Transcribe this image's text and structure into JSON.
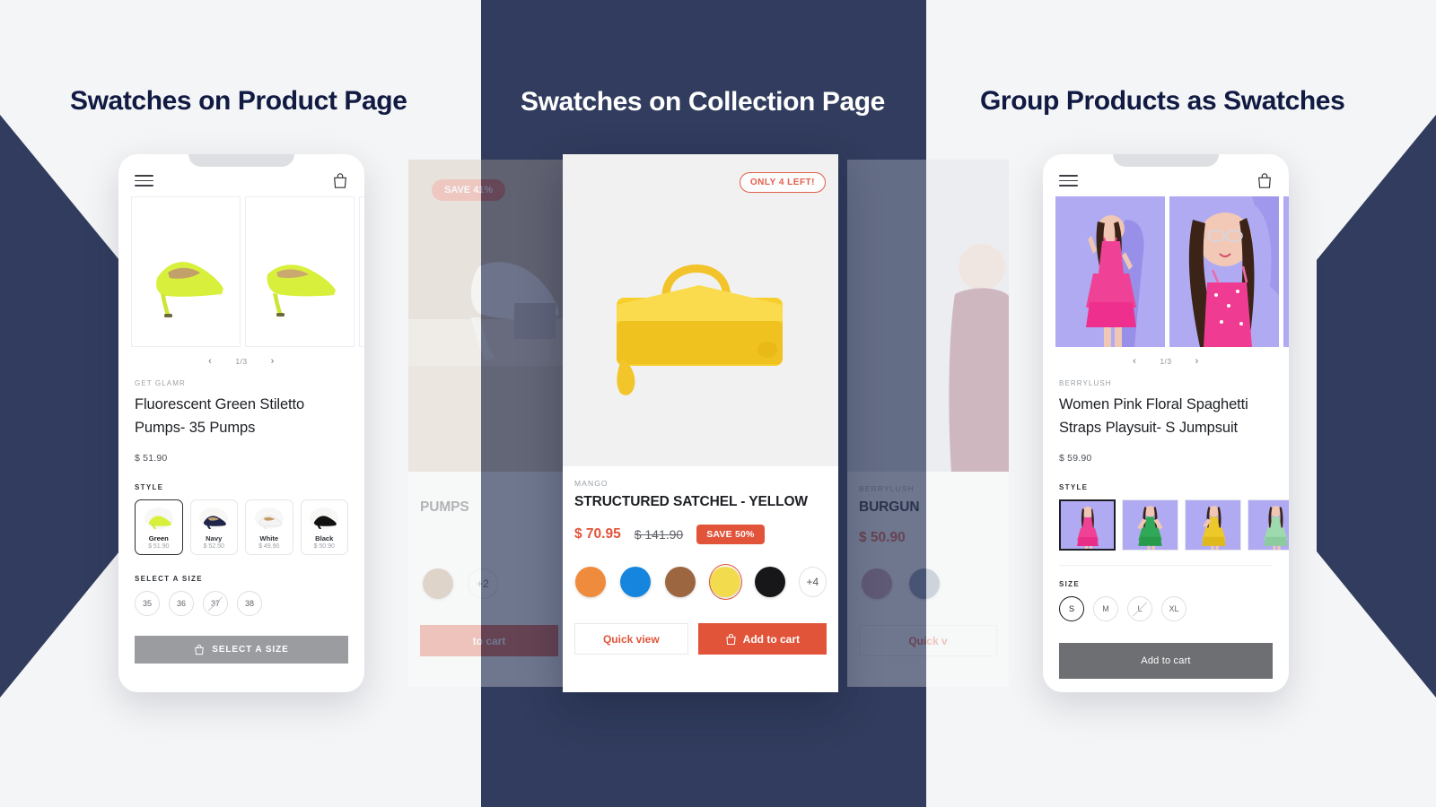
{
  "colors": {
    "navy": "#313c5e",
    "navy_title": "#101a42",
    "page_bg": "#f4f5f6",
    "accent_red": "#e1543a",
    "gray_cta": "#9a9ca0",
    "gray_cta_dark": "#6d6f72"
  },
  "panels": [
    {
      "title": "Swatches on Product Page"
    },
    {
      "title": "Swatches on Collection Page"
    },
    {
      "title": "Group Products as Swatches"
    }
  ],
  "product_page": {
    "carousel": {
      "counter": "1/3",
      "prev": "‹",
      "next": "›"
    },
    "vendor": "GET GLAMR",
    "title": "Fluorescent Green Stiletto Pumps- 35 Pumps",
    "price": "$ 51.90",
    "style_label": "STYLE",
    "styles": [
      {
        "name": "Green",
        "price": "$ 51.90",
        "selected": true,
        "color": "#d4f23a"
      },
      {
        "name": "Navy",
        "price": "$ 52.50",
        "selected": false,
        "color": "#20264a"
      },
      {
        "name": "White",
        "price": "$ 49.90",
        "selected": false,
        "color": "#f2f2f2"
      },
      {
        "name": "Black",
        "price": "$ 50.90",
        "selected": false,
        "color": "#121212"
      }
    ],
    "size_label": "SELECT A SIZE",
    "sizes": [
      {
        "label": "35",
        "selected": false,
        "unavailable": false
      },
      {
        "label": "36",
        "selected": false,
        "unavailable": false
      },
      {
        "label": "37",
        "selected": false,
        "unavailable": true
      },
      {
        "label": "38",
        "selected": false,
        "unavailable": false
      }
    ],
    "cta": "SELECT A SIZE"
  },
  "collection_page": {
    "main_card": {
      "stock_badge": "ONLY 4 LEFT!",
      "vendor": "MANGO",
      "title": "STRUCTURED SATCHEL - YELLOW",
      "price_now": "$ 70.95",
      "price_was": "$ 141.90",
      "save_pill": "SAVE 50%",
      "swatches": [
        {
          "name": "orange",
          "color": "#ef8b3c",
          "selected": false
        },
        {
          "name": "blue",
          "color": "#1585de",
          "selected": false
        },
        {
          "name": "brown",
          "color": "#9c6640",
          "selected": false
        },
        {
          "name": "yellow",
          "color": "#f2dc4e",
          "selected": true
        },
        {
          "name": "black",
          "color": "#17171a",
          "selected": false
        }
      ],
      "more_swatches": "+4",
      "quick_view": "Quick view",
      "add_to_cart": "Add to cart"
    },
    "left_card": {
      "save_badge": "SAVE 41%",
      "title": "PUMPS",
      "more_swatches": "+2",
      "swatch_color": "#b08b68",
      "add_to_cart": "to cart"
    },
    "right_card": {
      "vendor": "BERRYLUSH",
      "title": "BURGUN",
      "price_now": "$ 50.90",
      "swatches": [
        {
          "name": "pink",
          "color": "#c99cb0"
        },
        {
          "name": "slate-blue",
          "color": "#7a8ba3"
        }
      ],
      "quick_view": "Quick v"
    }
  },
  "group_products": {
    "carousel": {
      "counter": "1/3",
      "prev": "‹",
      "next": "›"
    },
    "vendor": "BERRYLUSH",
    "title": "Women Pink Floral Spaghetti Straps Playsuit- S Jumpsuit",
    "price": "$ 59.90",
    "style_label": "STYLE",
    "styles": [
      {
        "name": "pink",
        "color": "#e83f8e",
        "selected": true
      },
      {
        "name": "green",
        "color": "#2fa857",
        "selected": false
      },
      {
        "name": "yellow",
        "color": "#edc82a",
        "selected": false
      },
      {
        "name": "mint",
        "color": "#9fd9ae",
        "selected": false
      }
    ],
    "size_label": "SIZE",
    "sizes": [
      {
        "label": "S",
        "selected": true,
        "unavailable": false
      },
      {
        "label": "M",
        "selected": false,
        "unavailable": false
      },
      {
        "label": "L",
        "selected": false,
        "unavailable": true
      },
      {
        "label": "XL",
        "selected": false,
        "unavailable": false
      }
    ],
    "cta": "Add to cart"
  }
}
